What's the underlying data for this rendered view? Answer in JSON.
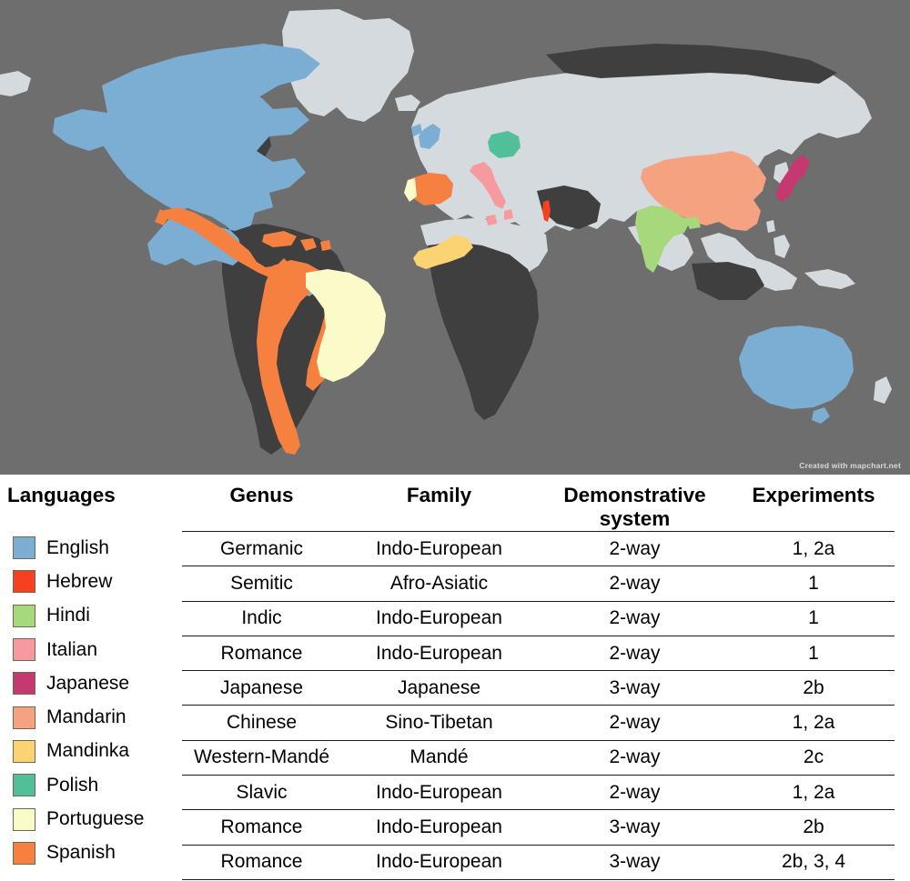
{
  "map": {
    "credit": "Created with mapchart.net",
    "ocean_color": "#6e6e6e",
    "land_color": "#d4dadd",
    "unhighlighted_land_color": "#3f3f3f",
    "highlighted_regions": [
      {
        "name": "United States / Canada / Australia / United Kingdom",
        "language": "English",
        "color": "#7caed4"
      },
      {
        "name": "Israel",
        "language": "Hebrew",
        "color": "#f5411f"
      },
      {
        "name": "India",
        "language": "Hindi",
        "color": "#a7d87c"
      },
      {
        "name": "Italy",
        "language": "Italian",
        "color": "#f79a9e"
      },
      {
        "name": "Japan",
        "language": "Japanese",
        "color": "#c4396f"
      },
      {
        "name": "China",
        "language": "Mandarin",
        "color": "#f5a281"
      },
      {
        "name": "Mali / Senegal / Gambia / Guinea",
        "language": "Mandinka",
        "color": "#fbd372"
      },
      {
        "name": "Poland",
        "language": "Polish",
        "color": "#52bf9b"
      },
      {
        "name": "Brazil / Portugal",
        "language": "Portuguese",
        "color": "#fbfbc9"
      },
      {
        "name": "Spain / Mexico / Central & South America",
        "language": "Spanish",
        "color": "#f6803f"
      }
    ]
  },
  "table": {
    "headers": {
      "languages": "Languages",
      "genus": "Genus",
      "family": "Family",
      "demonstrative_system": "Demonstrative system",
      "demonstrative_system_line1": "Demonstrative",
      "demonstrative_system_line2": "system",
      "experiments": "Experiments"
    },
    "legend": [
      {
        "label": "English",
        "color": "#7caed4"
      },
      {
        "label": "Hebrew",
        "color": "#f5411f"
      },
      {
        "label": "Hindi",
        "color": "#a7d87c"
      },
      {
        "label": "Italian",
        "color": "#f79a9e"
      },
      {
        "label": "Japanese",
        "color": "#c4396f"
      },
      {
        "label": "Mandarin",
        "color": "#f5a281"
      },
      {
        "label": "Mandinka",
        "color": "#fbd372"
      },
      {
        "label": "Polish",
        "color": "#52bf9b"
      },
      {
        "label": "Portuguese",
        "color": "#fbfbc9"
      },
      {
        "label": "Spanish",
        "color": "#f6803f"
      }
    ],
    "rows": [
      {
        "language": "English",
        "genus": "Germanic",
        "family": "Indo-European",
        "demonstrative_system": "2-way",
        "experiments": "1, 2a"
      },
      {
        "language": "Hebrew",
        "genus": "Semitic",
        "family": "Afro-Asiatic",
        "demonstrative_system": "2-way",
        "experiments": "1"
      },
      {
        "language": "Hindi",
        "genus": "Indic",
        "family": "Indo-European",
        "demonstrative_system": "2-way",
        "experiments": "1"
      },
      {
        "language": "Italian",
        "genus": "Romance",
        "family": "Indo-European",
        "demonstrative_system": "2-way",
        "experiments": "1"
      },
      {
        "language": "Japanese",
        "genus": "Japanese",
        "family": "Japanese",
        "demonstrative_system": "3-way",
        "experiments": "2b"
      },
      {
        "language": "Mandarin",
        "genus": "Chinese",
        "family": "Sino-Tibetan",
        "demonstrative_system": "2-way",
        "experiments": "1, 2a"
      },
      {
        "language": "Mandinka",
        "genus": "Western-Mandé",
        "family": "Mandé",
        "demonstrative_system": "2-way",
        "experiments": "2c"
      },
      {
        "language": "Polish",
        "genus": "Slavic",
        "family": "Indo-European",
        "demonstrative_system": "2-way",
        "experiments": "1, 2a"
      },
      {
        "language": "Portuguese",
        "genus": "Romance",
        "family": "Indo-European",
        "demonstrative_system": "3-way",
        "experiments": "2b"
      },
      {
        "language": "Spanish",
        "genus": "Romance",
        "family": "Indo-European",
        "demonstrative_system": "3-way",
        "experiments": "2b, 3, 4"
      }
    ]
  }
}
